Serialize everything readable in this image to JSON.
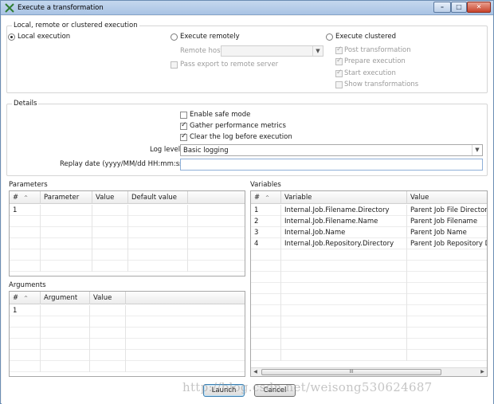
{
  "window": {
    "title": "Execute a transformation",
    "buttons": {
      "minimize": "–",
      "maximize": "□",
      "close": "✕"
    }
  },
  "execution": {
    "group_title": "Local, remote or clustered execution",
    "local": {
      "label": "Local execution",
      "selected": true
    },
    "remote": {
      "label": "Execute remotely",
      "selected": false,
      "remote_host_label": "Remote host",
      "remote_host_value": "",
      "pass_export_label": "Pass export to remote server",
      "pass_export_checked": false
    },
    "clustered": {
      "label": "Execute clustered",
      "selected": false,
      "options": [
        {
          "label": "Post transformation",
          "checked": true
        },
        {
          "label": "Prepare execution",
          "checked": true
        },
        {
          "label": "Start execution",
          "checked": true
        },
        {
          "label": "Show transformations",
          "checked": false
        }
      ]
    }
  },
  "details": {
    "group_title": "Details",
    "safe_mode": {
      "label": "Enable safe mode",
      "checked": false
    },
    "gather_metrics": {
      "label": "Gather performance metrics",
      "checked": true
    },
    "clear_log": {
      "label": "Clear the log before execution",
      "checked": true
    },
    "log_level_label": "Log level",
    "log_level_value": "Basic logging",
    "replay_date_label": "Replay date (yyyy/MM/dd HH:mm:ss)",
    "replay_date_value": ""
  },
  "parameters": {
    "label": "Parameters",
    "columns": [
      "#",
      "Parameter",
      "Value",
      "Default value"
    ],
    "rows": [
      [
        "1",
        "",
        "",
        ""
      ]
    ]
  },
  "arguments": {
    "label": "Arguments",
    "columns": [
      "#",
      "Argument",
      "Value"
    ],
    "rows": [
      [
        "1",
        "",
        ""
      ]
    ]
  },
  "variables": {
    "label": "Variables",
    "columns": [
      "#",
      "Variable",
      "Value"
    ],
    "rows": [
      [
        "1",
        "Internal.Job.Filename.Directory",
        "Parent Job File Directory"
      ],
      [
        "2",
        "Internal.Job.Filename.Name",
        "Parent Job Filename"
      ],
      [
        "3",
        "Internal.Job.Name",
        "Parent Job Name"
      ],
      [
        "4",
        "Internal.Job.Repository.Directory",
        "Parent Job Repository Dir"
      ]
    ],
    "scroll_thumb": "III"
  },
  "footer": {
    "launch_label": "Launch",
    "cancel_label": "Cancel"
  },
  "watermark": "http://blog.csdn.net/weisong530624687",
  "colors": {
    "title_bar": "#a9c3e4",
    "default_button_border": "#3c7fb1",
    "close_button": "#c8432b"
  }
}
